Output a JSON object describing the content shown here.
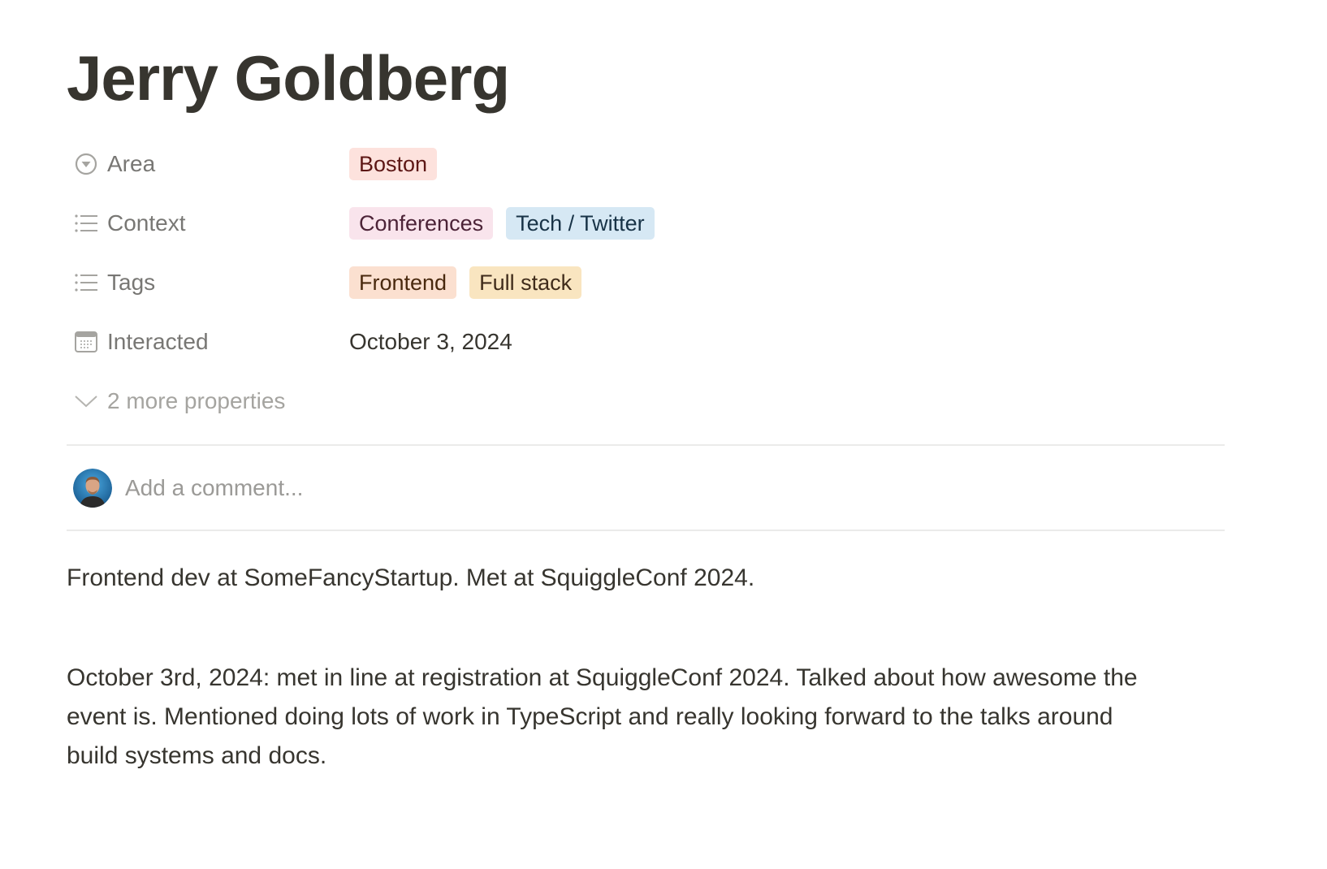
{
  "page": {
    "title": "Jerry Goldberg"
  },
  "properties": [
    {
      "name": "Area",
      "icon": "select-icon",
      "type": "select",
      "values": [
        {
          "label": "Boston",
          "bg": "#fde2dd",
          "fg": "#5d1715"
        }
      ]
    },
    {
      "name": "Context",
      "icon": "multi-select-icon",
      "type": "multi_select",
      "values": [
        {
          "label": "Conferences",
          "bg": "#f9e4ec",
          "fg": "#4c2337"
        },
        {
          "label": "Tech / Twitter",
          "bg": "#d6e8f4",
          "fg": "#183347"
        }
      ]
    },
    {
      "name": "Tags",
      "icon": "multi-select-icon",
      "type": "multi_select",
      "values": [
        {
          "label": "Frontend",
          "bg": "#fbe0d0",
          "fg": "#49290e"
        },
        {
          "label": "Full stack",
          "bg": "#f9e5c0",
          "fg": "#402c1b"
        }
      ]
    },
    {
      "name": "Interacted",
      "icon": "calendar-icon",
      "type": "date",
      "value": "October 3, 2024"
    }
  ],
  "more_properties": {
    "label": "2 more properties",
    "icon": "chevron-down-icon"
  },
  "comment": {
    "placeholder": "Add a comment...",
    "avatar": "user-avatar"
  },
  "content": {
    "paragraphs": [
      "Frontend dev at SomeFancyStartup. Met at SquiggleConf 2024.",
      "October 3rd, 2024: met in line at registration at SquiggleConf 2024. Talked about how awesome the event is. Mentioned doing lots of work in TypeScript and really looking forward to the talks around build systems and docs."
    ]
  },
  "colors": {
    "text": "#37352f",
    "muted": "#787774",
    "divider": "#ebebea"
  }
}
